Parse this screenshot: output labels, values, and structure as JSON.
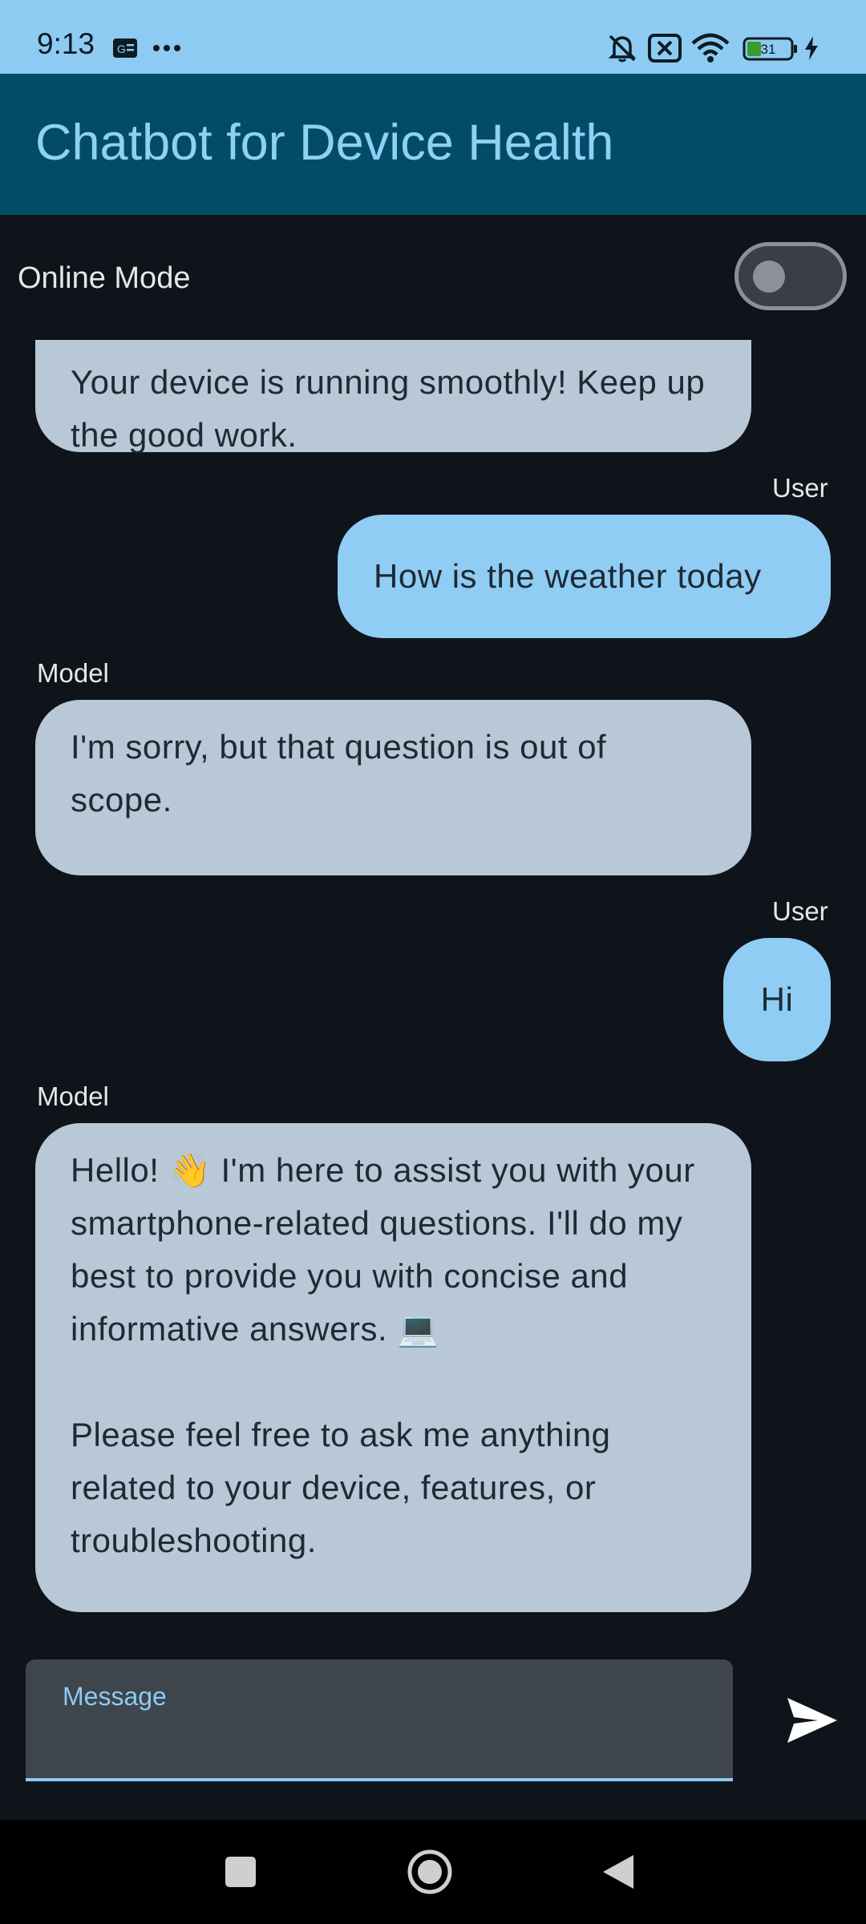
{
  "status_bar": {
    "time": "9:13",
    "icons": [
      "sim-card-icon",
      "more-dots-icon",
      "mute-bell-icon",
      "no-sim-icon",
      "wifi-icon",
      "battery-icon",
      "charging-icon"
    ],
    "battery_level": "31"
  },
  "app_bar": {
    "title": "Chatbot for Device Health"
  },
  "mode": {
    "label": "Online Mode",
    "toggle_on": false
  },
  "messages": [
    {
      "sender": "",
      "role": "model",
      "text": "Your device is running smoothly! Keep up the good work."
    },
    {
      "sender": "User",
      "role": "user",
      "text": "How is the weather today"
    },
    {
      "sender": "Model",
      "role": "model",
      "text": "I'm sorry, but that question is out of scope."
    },
    {
      "sender": "User",
      "role": "user",
      "text": "Hi"
    },
    {
      "sender": "Model",
      "role": "model",
      "text1": "Hello! 👋 I'm here to assist you with your smartphone-related questions. I'll do my best to provide you with concise and informative answers. 💻",
      "text2": "Please feel free to ask me anything related to your device, features, or troubleshooting."
    }
  ],
  "composer": {
    "label": "Message",
    "value": "",
    "send_icon": "send-icon"
  },
  "nav_bar": {
    "icons": [
      "recents-square-icon",
      "home-circle-icon",
      "back-triangle-icon"
    ]
  },
  "colors": {
    "status_bar": "#8ecbf2",
    "app_bar": "#034c68",
    "background": "#0f141a",
    "model_bubble": "#b8c8d6",
    "user_bubble": "#90cdf4"
  }
}
